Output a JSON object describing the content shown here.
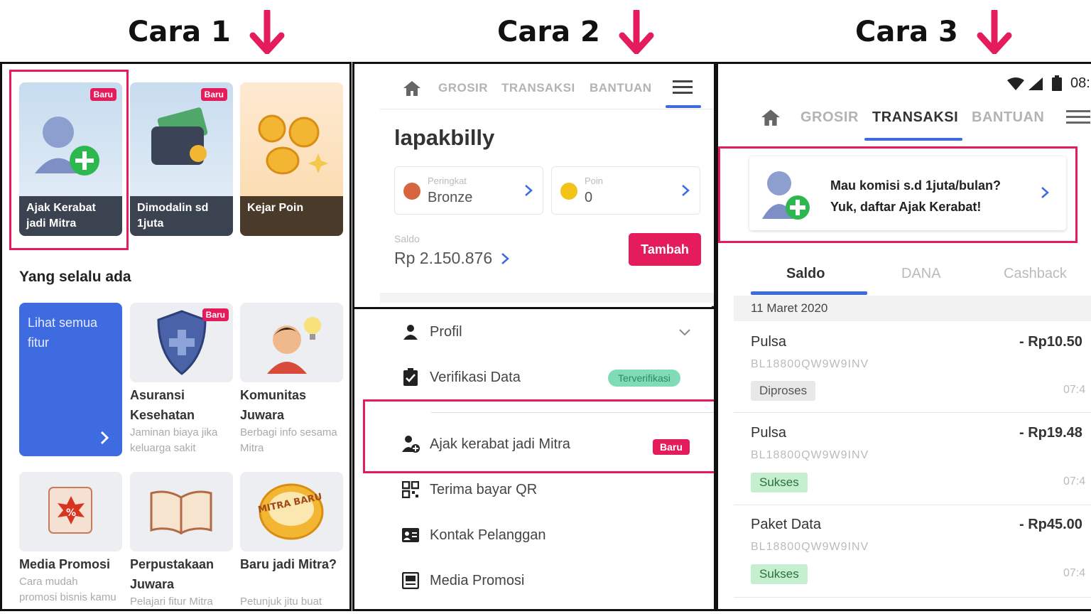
{
  "headings": [
    "Cara 1",
    "Cara 2",
    "Cara 3"
  ],
  "colors": {
    "accent": "#e41c5b",
    "blue": "#3f6be0",
    "green": "#3bb87a"
  },
  "panel1": {
    "cards": [
      {
        "label": "Ajak Kerabat jadi Mitra",
        "badge": "Baru",
        "icon": "add-user-icon"
      },
      {
        "label": "Dimodalin sd 1juta",
        "badge": "Baru",
        "icon": "wallet-icon"
      },
      {
        "label": "Kejar Poin",
        "badge": "",
        "icon": "coins-icon"
      }
    ],
    "section_title": "Yang selalu ada",
    "see_all": "Lihat semua fitur",
    "tiles": [
      {
        "title": "Asuransi Kesehatan",
        "subtitle": "Jaminan biaya jika keluarga sakit",
        "badge": "Baru",
        "icon": "shield-icon"
      },
      {
        "title": "Komunitas Juwara",
        "subtitle": "Berbagi info sesama Mitra",
        "badge": "",
        "icon": "community-icon"
      },
      {
        "title": "Media Promosi",
        "subtitle": "Cara mudah promosi bisnis kamu",
        "badge": "",
        "icon": "promo-icon"
      },
      {
        "title": "Perpustakaan Juwara",
        "subtitle": "Pelajari fitur Mitra",
        "badge": "",
        "icon": "book-icon"
      },
      {
        "title": "Baru jadi Mitra?",
        "subtitle": "Petunjuk jitu buat",
        "badge": "",
        "icon": "mitra-baru-icon"
      }
    ],
    "mitra_stamp": "MITRA BARU"
  },
  "panel2": {
    "nav": {
      "tabs": [
        "GROSIR",
        "TRANSAKSI",
        "BANTUAN"
      ]
    },
    "username": "lapakbilly",
    "rank": {
      "label": "Peringkat",
      "value": "Bronze"
    },
    "points": {
      "label": "Poin",
      "value": "0"
    },
    "balance": {
      "label": "Saldo",
      "value": "Rp 2.150.876"
    },
    "topup_button": "Tambah",
    "menu": [
      {
        "label": "Profil",
        "icon": "person-icon"
      },
      {
        "label": "Verifikasi Data",
        "icon": "clipboard-check-icon",
        "badge": "Terverifikasi"
      },
      {
        "label": "Ajak kerabat jadi Mitra",
        "icon": "add-user-icon",
        "badge": "Baru"
      },
      {
        "label": "Terima bayar QR",
        "icon": "qr-icon"
      },
      {
        "label": "Kontak Pelanggan",
        "icon": "contact-icon"
      },
      {
        "label": "Media Promosi",
        "icon": "promo-icon"
      }
    ]
  },
  "panel3": {
    "status_time": "08:",
    "nav": {
      "tabs": [
        "GROSIR",
        "TRANSAKSI",
        "BANTUAN"
      ],
      "active": "TRANSAKSI"
    },
    "promo": {
      "line1": "Mau komisi s.d 1juta/bulan?",
      "line2": "Yuk, daftar Ajak Kerabat!"
    },
    "tabs": [
      "Saldo",
      "DANA",
      "Cashback"
    ],
    "date": "11 Maret 2020",
    "transactions": [
      {
        "name": "Pulsa",
        "code": "BL18800QW9W9INV",
        "amount": "- Rp10.50",
        "status": "Diproses",
        "time": "07:4"
      },
      {
        "name": "Pulsa",
        "code": "BL18800QW9W9INV",
        "amount": "- Rp19.48",
        "status": "Sukses",
        "time": "07:4"
      },
      {
        "name": "Paket Data",
        "code": "BL18800QW9W9INV",
        "amount": "- Rp45.00",
        "status": "Sukses",
        "time": "07:4"
      }
    ]
  }
}
